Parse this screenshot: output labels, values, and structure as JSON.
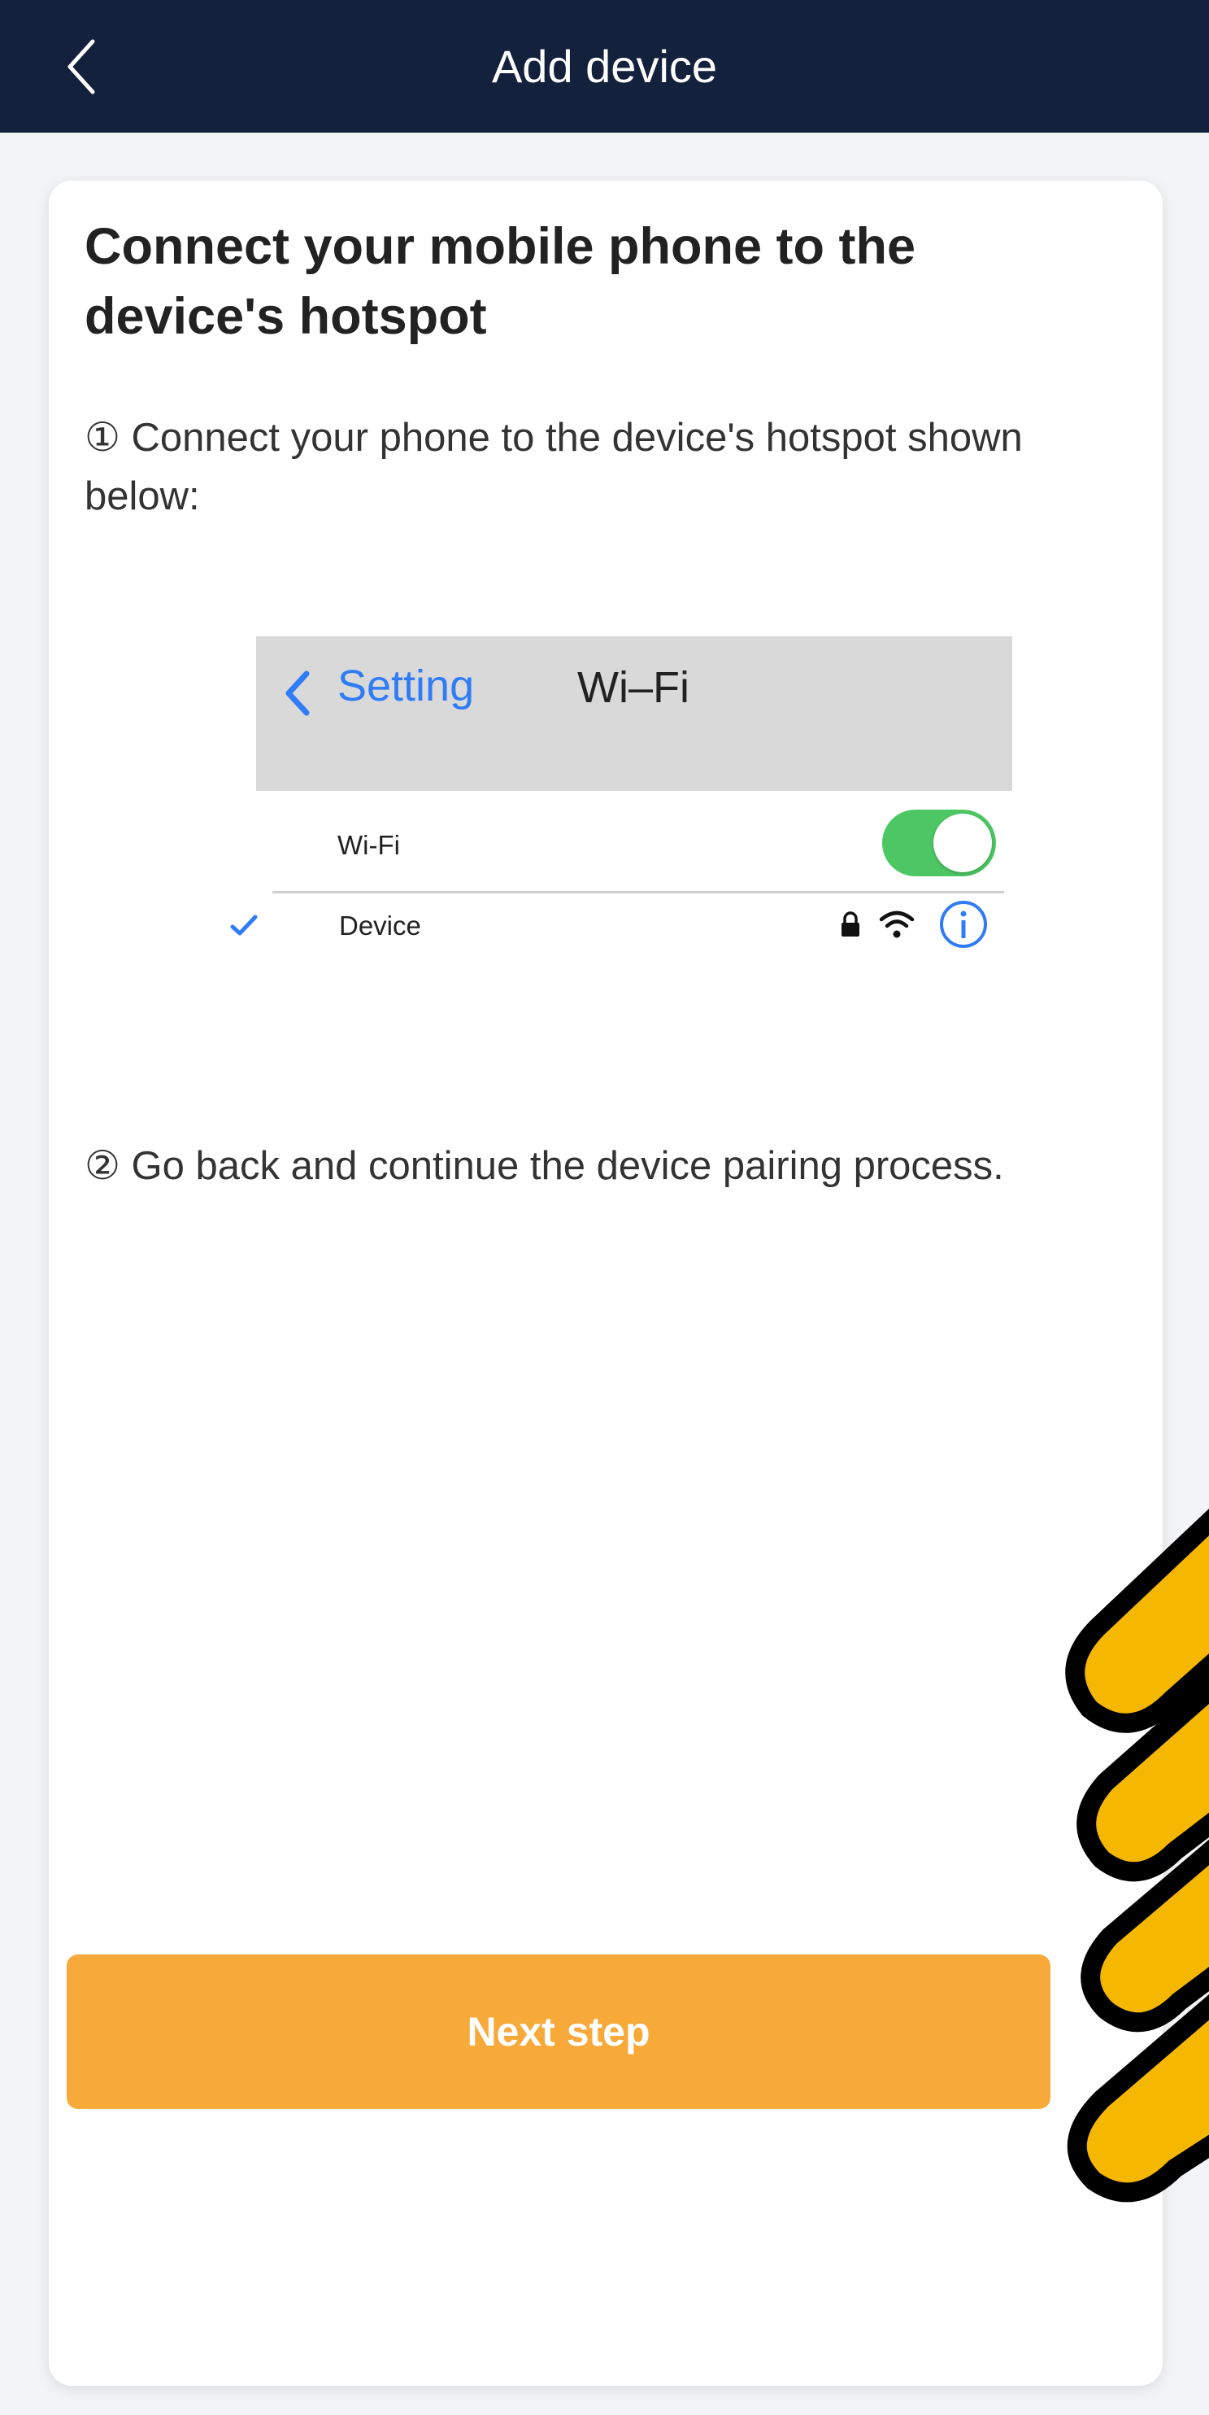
{
  "header": {
    "title": "Add device",
    "back_icon": "chevron-left-icon"
  },
  "content": {
    "heading": "Connect your mobile phone to the device's hotspot",
    "step1": "① Connect your phone to the device's hotspot shown below:",
    "step2": "② Go back and continue the device pairing process."
  },
  "illustration": {
    "back_label": "Setting",
    "screen_title": "Wi–Fi",
    "wifi_label": "Wi-Fi",
    "wifi_enabled": true,
    "network_name": "Device",
    "icons": [
      "check-icon",
      "lock-icon",
      "wifi-signal-icon",
      "info-icon"
    ]
  },
  "actions": {
    "next_label": "Next step"
  },
  "colors": {
    "topbar": "#14213d",
    "button": "#f7a93a",
    "ios_blue": "#2f7cf6",
    "toggle_on": "#4cc764",
    "hand_fill": "#f6b700"
  }
}
